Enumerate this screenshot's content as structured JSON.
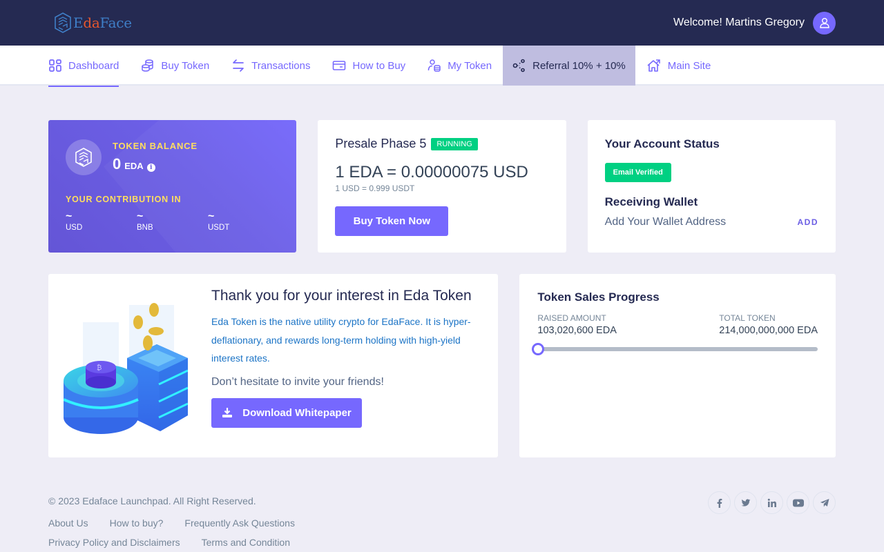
{
  "header": {
    "logo": {
      "part1": "E",
      "part2": "da",
      "part3": "Face"
    },
    "welcome": "Welcome! Martins Gregory"
  },
  "nav": {
    "items": [
      {
        "label": "Dashboard",
        "icon": "dashboard-icon",
        "active": true
      },
      {
        "label": "Buy Token",
        "icon": "coins-icon"
      },
      {
        "label": "Transactions",
        "icon": "transfer-icon"
      },
      {
        "label": "How to Buy",
        "icon": "card-icon"
      },
      {
        "label": "My Token",
        "icon": "user-token-icon"
      },
      {
        "label": "Referral 10% + 10%",
        "icon": "share-icon",
        "highlighted": true
      },
      {
        "label": "Main Site",
        "icon": "home-icon"
      }
    ]
  },
  "balance": {
    "label": "TOKEN BALANCE",
    "value": "0",
    "unit": "EDA",
    "contribution_label": "YOUR CONTRIBUTION IN",
    "contributions": [
      {
        "amount": "~",
        "currency": "USD"
      },
      {
        "amount": "~",
        "currency": "BNB"
      },
      {
        "amount": "~",
        "currency": "USDT"
      }
    ]
  },
  "presale": {
    "title": "Presale Phase 5",
    "status": "RUNNING",
    "rate": "1 EDA = 0.00000075 USD",
    "subrate": "1 USD = 0.999 USDT",
    "button": "Buy Token Now"
  },
  "account": {
    "title": "Your Account Status",
    "email_status": "Email Verified",
    "wallet_title": "Receiving Wallet",
    "wallet_placeholder": "Add Your Wallet Address",
    "add_label": "ADD"
  },
  "welcome_card": {
    "title": "Thank you for your interest in Eda Token",
    "description": "Eda Token is the native utility crypto for EdaFace. It is hyper-deflationary, and rewards long-term holding with high-yield interest rates.",
    "invite": "Don’t hesitate to invite your friends!",
    "button": "Download Whitepaper"
  },
  "progress": {
    "title": "Token Sales Progress",
    "raised_label": "RAISED AMOUNT",
    "raised_value": "103,020,600 EDA",
    "total_label": "TOTAL TOKEN",
    "total_value": "214,000,000,000 EDA",
    "percent": 0.05
  },
  "footer": {
    "copyright": "© 2023 Edaface Launchpad. All Right Reserved.",
    "links": [
      "About Us",
      "How to buy?",
      "Frequently Ask Questions",
      "Privacy Policy and Disclaimers",
      "Terms and Condition"
    ],
    "social": [
      "facebook-icon",
      "twitter-icon",
      "linkedin-icon",
      "youtube-icon",
      "telegram-icon"
    ]
  },
  "colors": {
    "primary": "#7668fe",
    "header_bg": "#252a52",
    "success": "#00d082",
    "accent_yellow": "#ffde5f"
  }
}
